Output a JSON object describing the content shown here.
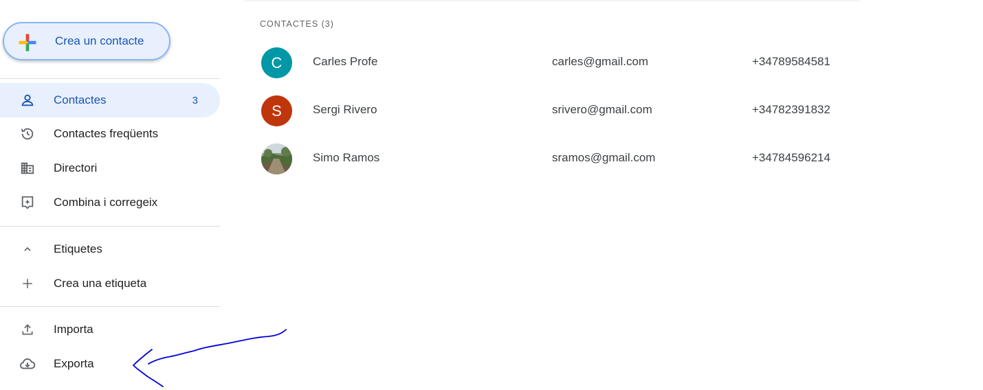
{
  "sidebar": {
    "create_label": "Crea un contacte",
    "items": [
      {
        "label": "Contactes",
        "count": "3",
        "icon": "person-icon"
      },
      {
        "label": "Contactes freqüents",
        "icon": "history-icon"
      },
      {
        "label": "Directori",
        "icon": "building-icon"
      },
      {
        "label": "Combina i corregeix",
        "icon": "merge-fix-icon"
      }
    ],
    "labels_section": {
      "label": "Etiquetes",
      "icon": "chevron-up-icon"
    },
    "create_label_item": {
      "label": "Crea una etiqueta",
      "icon": "plus-icon"
    },
    "import": {
      "label": "Importa",
      "icon": "upload-icon"
    },
    "export": {
      "label": "Exporta",
      "icon": "cloud-download-icon"
    }
  },
  "main": {
    "section_header": "CONTACTES (3)",
    "contacts": [
      {
        "initial": "C",
        "name": "Carles Profe",
        "email": "carles@gmail.com",
        "phone": "+34789584581",
        "avatar_color": "#0097a7"
      },
      {
        "initial": "S",
        "name": "Sergi Rivero",
        "email": "srivero@gmail.com",
        "phone": "+34782391832",
        "avatar_color": "#bf360c"
      },
      {
        "initial": "",
        "name": "Simo Ramos",
        "email": "sramos@gmail.com",
        "phone": "+34784596214",
        "avatar_color": "photo"
      }
    ]
  },
  "colors": {
    "accent": "#1a73e8",
    "active_bg": "#e8f0fe",
    "annotation": "#0000dd"
  }
}
